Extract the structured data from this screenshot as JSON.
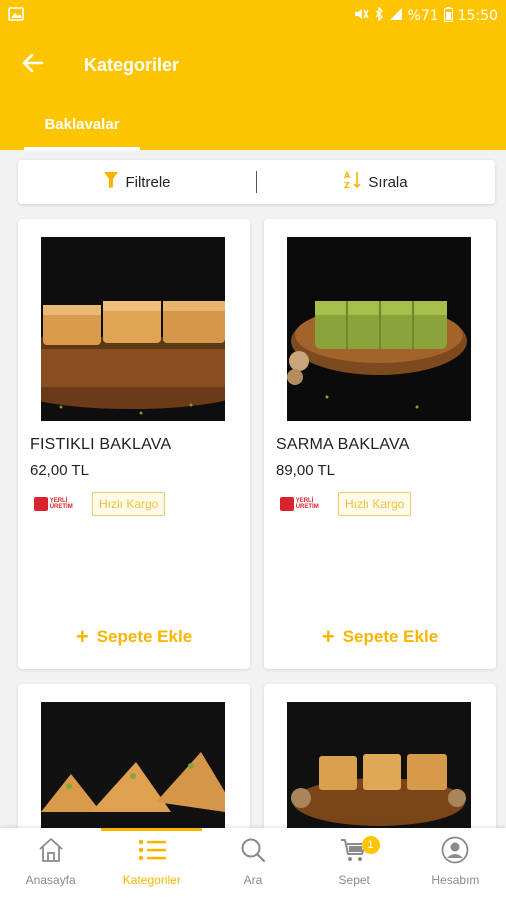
{
  "status_bar": {
    "battery": "%71",
    "time": "15:50",
    "icons": [
      "image-icon",
      "mute-icon",
      "bluetooth-icon",
      "signal-icon",
      "battery-icon"
    ]
  },
  "app_bar": {
    "title": "Kategoriler",
    "back_icon": "arrow-left-icon"
  },
  "tabs": [
    {
      "label": "Baklavalar",
      "active": true
    }
  ],
  "actions": {
    "filter_label": "Filtrele",
    "sort_label": "Sırala",
    "filter_icon": "funnel-icon",
    "sort_icon": "sort-az-icon"
  },
  "products": [
    {
      "name": "FISTIKLI BAKLAVA",
      "price": "62,00 TL",
      "badge_local": "YERLİ ÜRETİM",
      "badge_cargo": "Hızlı Kargo",
      "add_label": "Sepete Ekle",
      "image": "baklava-plain"
    },
    {
      "name": "SARMA BAKLAVA",
      "price": "89,00 TL",
      "badge_local": "YERLİ ÜRETİM",
      "badge_cargo": "Hızlı Kargo",
      "add_label": "Sepete Ekle",
      "image": "baklava-pistachio"
    },
    {
      "image": "baklava-wedges"
    },
    {
      "image": "baklava-walnut"
    }
  ],
  "bottom_nav": [
    {
      "label": "Anasayfa",
      "icon": "home-icon",
      "active": false
    },
    {
      "label": "Kategoriler",
      "icon": "list-icon",
      "active": true
    },
    {
      "label": "Ara",
      "icon": "search-icon",
      "active": false
    },
    {
      "label": "Sepet",
      "icon": "cart-icon",
      "active": false,
      "badge": "1"
    },
    {
      "label": "Hesabım",
      "icon": "account-icon",
      "active": false
    }
  ],
  "colors": {
    "brand": "#fdc500",
    "accent": "#f7b500",
    "local_badge": "#d9232d"
  }
}
